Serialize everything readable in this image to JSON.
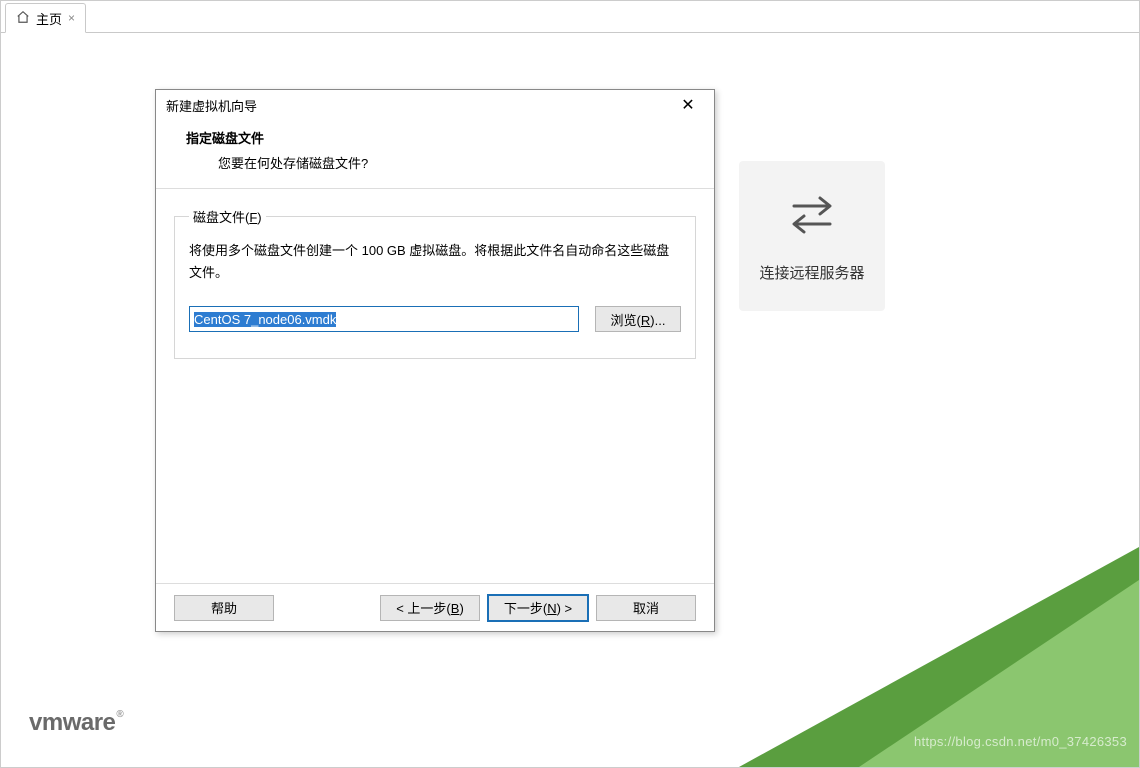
{
  "tab": {
    "label": "主页"
  },
  "bg_card": {
    "label": "连接远程服务器"
  },
  "dialog": {
    "title": "新建虚拟机向导",
    "heading": "指定磁盘文件",
    "subheading": "您要在何处存储磁盘文件?",
    "group_legend_prefix": "磁盘文件(",
    "group_legend_key": "F",
    "group_legend_suffix": ")",
    "description": "将使用多个磁盘文件创建一个 100 GB 虚拟磁盘。将根据此文件名自动命名这些磁盘文件。",
    "file_value": "CentOS 7_node06.vmdk",
    "browse_prefix": "浏览(",
    "browse_key": "R",
    "browse_suffix": ")...",
    "help": "帮助",
    "back_prefix": "< 上一步(",
    "back_key": "B",
    "back_suffix": ")",
    "next_prefix": "下一步(",
    "next_key": "N",
    "next_suffix": ") >",
    "cancel": "取消"
  },
  "logo": {
    "text_plain": "vmware"
  },
  "watermark": "https://blog.csdn.net/m0_37426353"
}
